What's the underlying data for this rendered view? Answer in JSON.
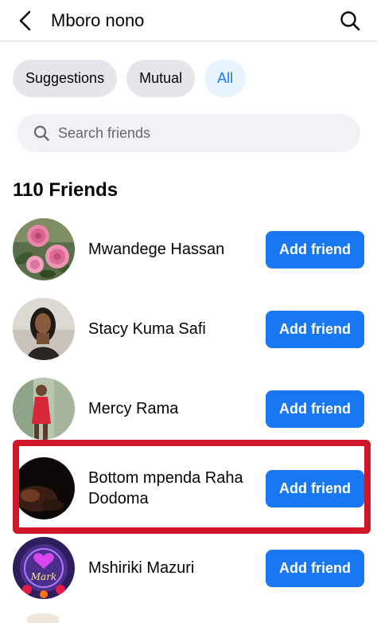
{
  "header": {
    "title": "Mboro nono",
    "back_icon": "chevron-left-icon",
    "search_icon": "search-icon"
  },
  "filters": [
    {
      "label": "Suggestions",
      "active": false
    },
    {
      "label": "Mutual",
      "active": false
    },
    {
      "label": "All",
      "active": true
    }
  ],
  "search": {
    "placeholder": "Search friends",
    "value": ""
  },
  "friends_count_label": "110 Friends",
  "friends": [
    {
      "name": "Mwandege Hassan",
      "action": "Add friend",
      "avatar": "pink-roses"
    },
    {
      "name": "Stacy Kuma Safi",
      "action": "Add friend",
      "avatar": "woman-portrait"
    },
    {
      "name": "Mercy Rama",
      "action": "Add friend",
      "avatar": "woman-red-dress"
    },
    {
      "name": "Bottom mpenda Raha Dodoma",
      "action": "Add friend",
      "avatar": "dark-photo"
    },
    {
      "name": "Mshiriki Mazuri",
      "action": "Add friend",
      "avatar": "mark-logo"
    }
  ],
  "avatar_text": {
    "mark": "Mark"
  },
  "colors": {
    "accent": "#1877f2",
    "chip_bg": "#e4e6eb",
    "chip_active_bg": "#e7f3ff",
    "highlight": "#d0162b"
  }
}
